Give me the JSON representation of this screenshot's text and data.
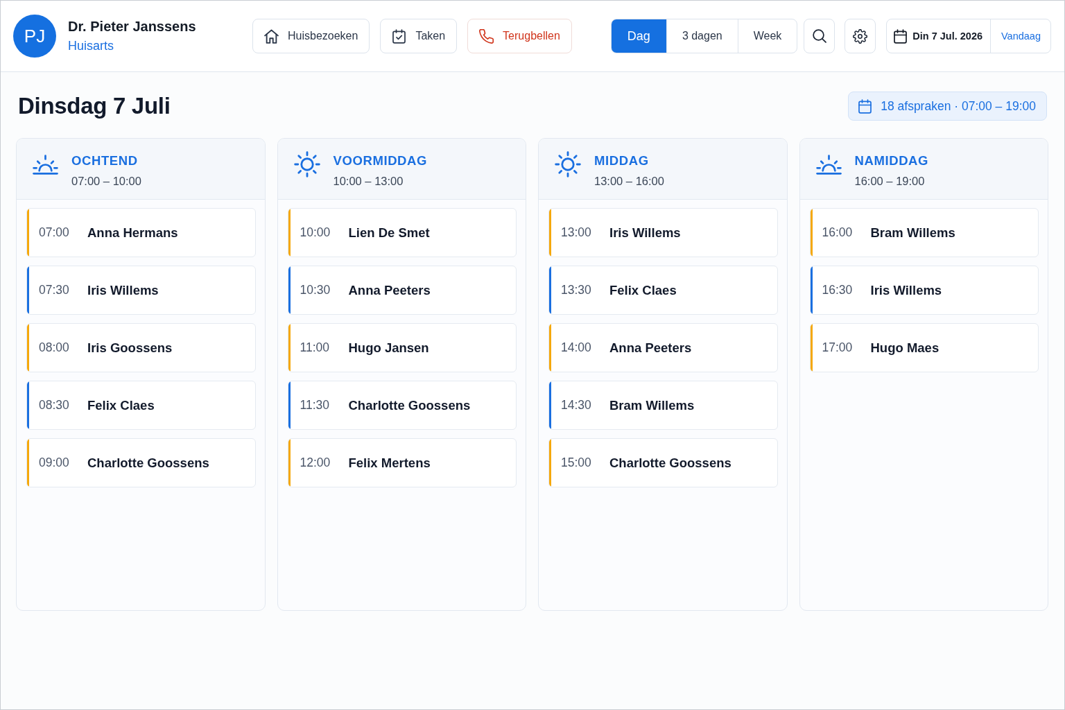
{
  "header": {
    "avatar_initials": "PJ",
    "name": "Dr. Pieter Janssens",
    "role": "Huisarts"
  },
  "toolbar": [
    {
      "label": "Huisbezoeken",
      "kind": "default"
    },
    {
      "label": "Taken",
      "kind": "default"
    },
    {
      "label": "Terugbellen",
      "kind": "urgent"
    }
  ],
  "views": [
    {
      "label": "Dag",
      "selected": true
    },
    {
      "label": "3 dagen",
      "selected": false
    },
    {
      "label": "Week",
      "selected": false
    }
  ],
  "date_picker": {
    "date": "Din 7 Jul. 2026",
    "today": "Vandaag"
  },
  "day": {
    "title": "Dinsdag 7 Juli",
    "summary": "18 afspraken · 07:00 – 19:00"
  },
  "periods": [
    {
      "kind": "sunrise",
      "title": "OCHTEND",
      "range": "07:00 – 10:00",
      "appointments": [
        {
          "time": "07:00",
          "patient": "Anna Hermans",
          "color": "#f5a80c"
        },
        {
          "time": "07:30",
          "patient": "Iris Willems",
          "color": "#1a6fe0"
        },
        {
          "time": "08:00",
          "patient": "Iris Goossens",
          "color": "#f5a80c"
        },
        {
          "time": "08:30",
          "patient": "Felix Claes",
          "color": "#1a6fe0"
        },
        {
          "time": "09:00",
          "patient": "Charlotte Goossens",
          "color": "#f5a80c"
        }
      ]
    },
    {
      "kind": "sun",
      "title": "VOORMIDDAG",
      "range": "10:00 – 13:00",
      "appointments": [
        {
          "time": "10:00",
          "patient": "Lien De Smet",
          "color": "#f5a80c"
        },
        {
          "time": "10:30",
          "patient": "Anna Peeters",
          "color": "#1a6fe0"
        },
        {
          "time": "11:00",
          "patient": "Hugo Jansen",
          "color": "#f5a80c"
        },
        {
          "time": "11:30",
          "patient": "Charlotte Goossens",
          "color": "#1a6fe0"
        },
        {
          "time": "12:00",
          "patient": "Felix Mertens",
          "color": "#f5a80c"
        }
      ]
    },
    {
      "kind": "sun",
      "title": "MIDDAG",
      "range": "13:00 – 16:00",
      "appointments": [
        {
          "time": "13:00",
          "patient": "Iris Willems",
          "color": "#f5a80c"
        },
        {
          "time": "13:30",
          "patient": "Felix Claes",
          "color": "#1a6fe0"
        },
        {
          "time": "14:00",
          "patient": "Anna Peeters",
          "color": "#f5a80c"
        },
        {
          "time": "14:30",
          "patient": "Bram Willems",
          "color": "#1a6fe0"
        },
        {
          "time": "15:00",
          "patient": "Charlotte Goossens",
          "color": "#f5a80c"
        }
      ]
    },
    {
      "kind": "sunrise",
      "title": "NAMIDDAG",
      "range": "16:00 – 19:00",
      "appointments": [
        {
          "time": "16:00",
          "patient": "Bram Willems",
          "color": "#f5a80c"
        },
        {
          "time": "16:30",
          "patient": "Iris Willems",
          "color": "#1a6fe0"
        },
        {
          "time": "17:00",
          "patient": "Hugo Maes",
          "color": "#f5a80c"
        }
      ]
    }
  ]
}
